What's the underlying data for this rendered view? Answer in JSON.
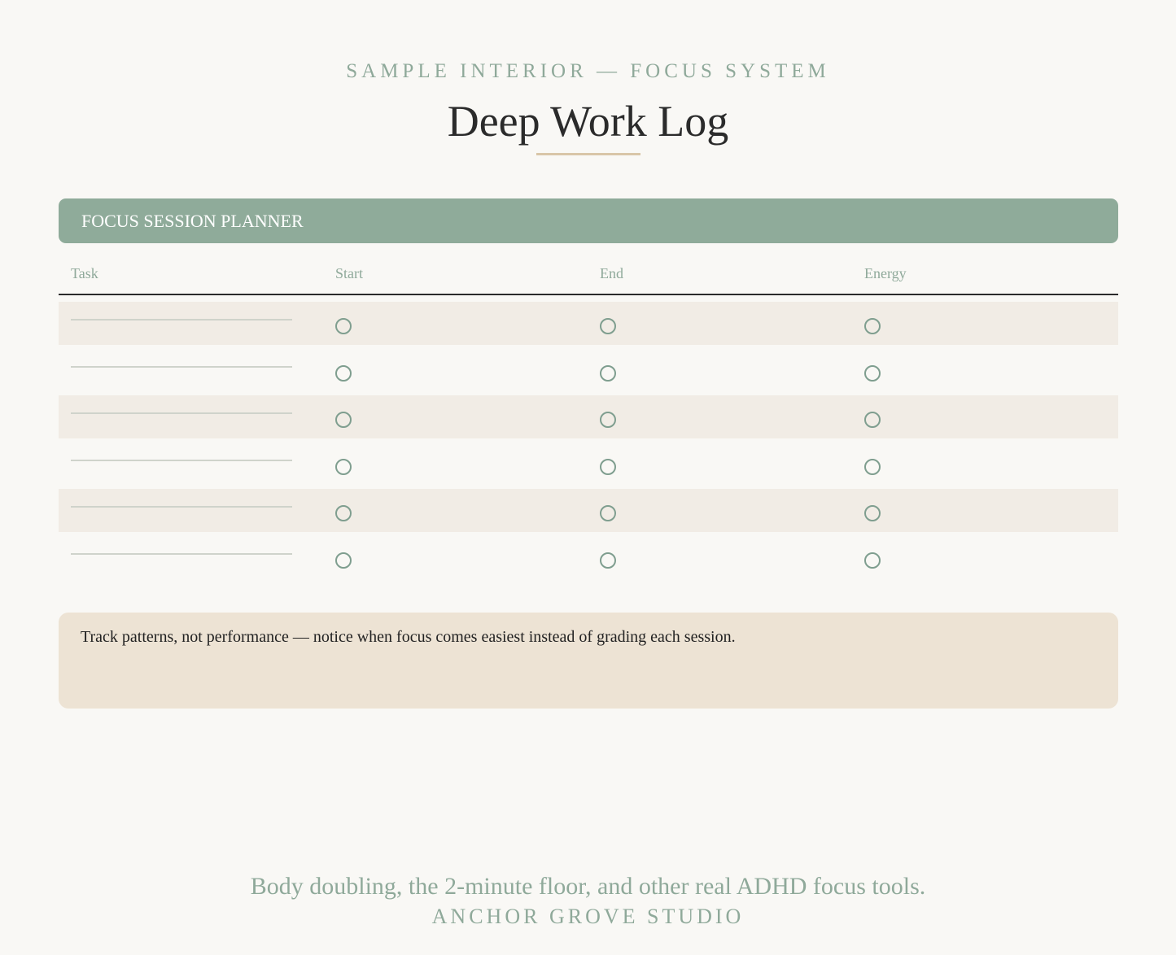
{
  "header": {
    "eyebrow": "SAMPLE INTERIOR — FOCUS SYSTEM",
    "title": "Deep Work Log"
  },
  "section": {
    "title": "FOCUS SESSION PLANNER"
  },
  "table": {
    "columns": [
      "Task",
      "Start",
      "End",
      "Energy"
    ],
    "row_count": 6
  },
  "note": {
    "text": "Track patterns, not performance — notice when focus comes easiest instead of grading each session."
  },
  "footer": {
    "tagline": "Body doubling, the 2-minute floor, and other real ADHD focus tools.",
    "brand": "ANCHOR GROVE STUDIO"
  },
  "colors": {
    "accent": "#8fab9a",
    "background": "#f9f8f5",
    "row_shade": "#f1ece5",
    "note_bg": "#ede3d4",
    "title_rule": "#d9c6a8"
  }
}
